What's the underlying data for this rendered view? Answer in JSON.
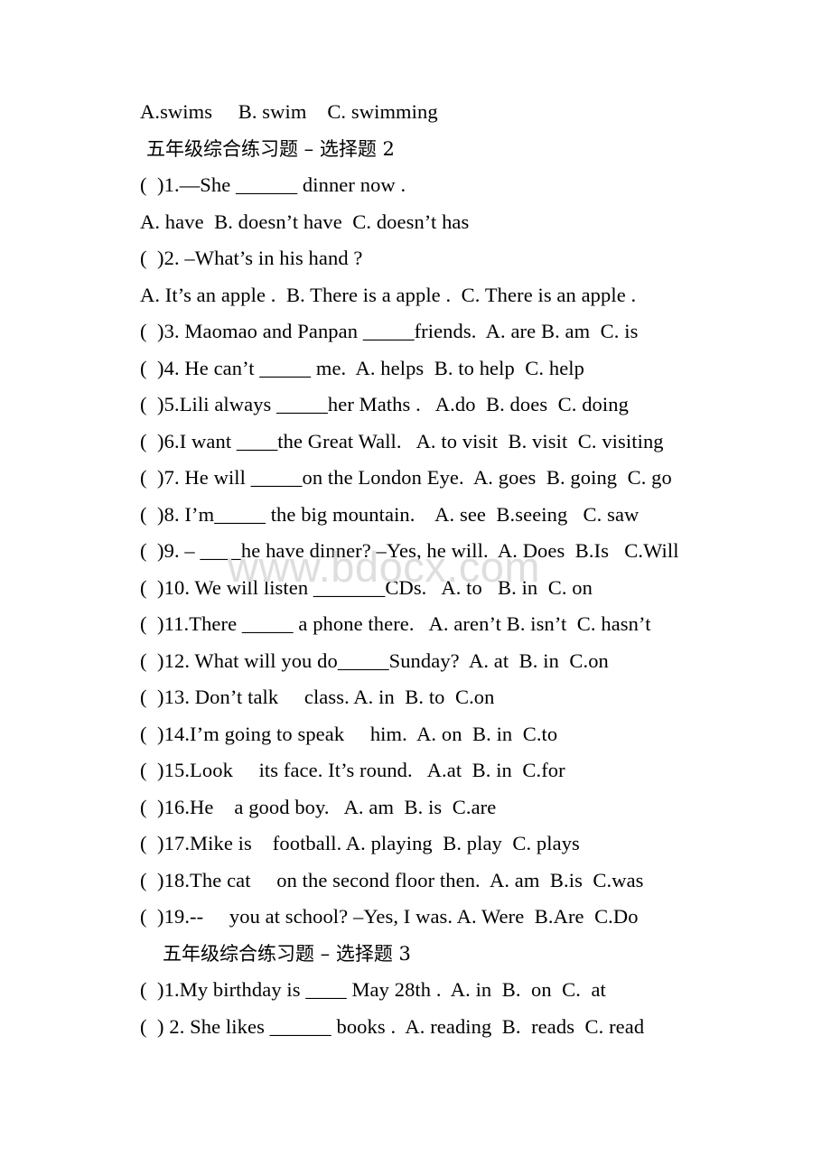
{
  "document": {
    "watermark": "www.bdocx.com",
    "lines": [
      {
        "type": "options",
        "text": "A.swims     B. swim    C. swimming"
      },
      {
        "type": "heading",
        "indent": 1,
        "text": "五年级综合练习题 – 选择题 2"
      },
      {
        "type": "question",
        "text": "(  )1.—She ______ dinner now ."
      },
      {
        "type": "options",
        "text": "A. have  B. doesn’t have  C. doesn’t has"
      },
      {
        "type": "question",
        "text": "(  )2. –What’s in his hand ?"
      },
      {
        "type": "options",
        "text": "A. It’s an apple .  B. There is a apple .  C. There is an apple ."
      },
      {
        "type": "question",
        "text": "(  )3. Maomao and Panpan _____friends.  A. are B. am  C. is"
      },
      {
        "type": "question",
        "text": "(  )4. He can’t _____ me.  A. helps  B. to help  C. help"
      },
      {
        "type": "question",
        "text": "(  )5.Lili always _____her Maths .   A.do  B. does  C. doing"
      },
      {
        "type": "question",
        "text": "(  )6.I want ____the Great Wall.   A. to visit  B. visit  C. visiting"
      },
      {
        "type": "question",
        "text": "(  )7. He will _____on the London Eye.  A. goes  B. going  C. go"
      },
      {
        "type": "question",
        "text": "(  )8. I’m_____ the big mountain.    A. see  B.seeing   C. saw"
      },
      {
        "type": "question",
        "text": "(  )9. – ____he have dinner? –Yes, he will.  A. Does  B.Is   C.Will"
      },
      {
        "type": "question",
        "text": "(  )10. We will listen _______CDs.   A. to   B. in  C. on"
      },
      {
        "type": "question",
        "text": "(  )11.There _____ a phone there.   A. aren’t B. isn’t  C. hasn’t"
      },
      {
        "type": "question",
        "text": "(  )12. What will you do_____Sunday?  A. at  B. in  C.on"
      },
      {
        "type": "question",
        "text": "(  )13. Don’t talk     class. A. in  B. to  C.on"
      },
      {
        "type": "question",
        "text": "(  )14.I’m going to speak     him.  A. on  B. in  C.to"
      },
      {
        "type": "question",
        "text": "(  )15.Look     its face. It’s round.   A.at  B. in  C.for"
      },
      {
        "type": "question",
        "text": "(  )16.He    a good boy.   A. am  B. is  C.are"
      },
      {
        "type": "question",
        "text": "(  )17.Mike is    football. A. playing  B. play  C. plays"
      },
      {
        "type": "question",
        "text": "(  )18.The cat     on the second floor then.  A. am  B.is  C.was"
      },
      {
        "type": "question",
        "text": "(  )19.--     you at school? –Yes, I was. A. Were  B.Are  C.Do"
      },
      {
        "type": "heading",
        "indent": 2,
        "text": "五年级综合练习题 – 选择题 3"
      },
      {
        "type": "question",
        "text": "(  )1.My birthday is ____ May 28th .  A. in  B.  on  C.  at"
      },
      {
        "type": "question",
        "text": "(  ) 2. She likes ______ books .  A. reading  B.  reads  C. read"
      }
    ]
  }
}
